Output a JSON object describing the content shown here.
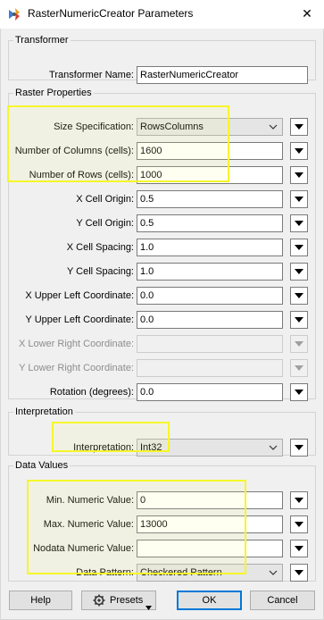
{
  "window": {
    "title": "RasterNumericCreator Parameters",
    "close_glyph": "✕"
  },
  "colors": {
    "highlight": "#f6f62a",
    "default_button_border": "#0078d7",
    "panel_background": "#f0f0f0"
  },
  "transformer": {
    "legend": "Transformer",
    "name_label": "Transformer Name:",
    "name_value": "RasterNumericCreator"
  },
  "raster_properties": {
    "legend": "Raster Properties",
    "size_spec_label": "Size Specification:",
    "size_spec_value": "RowsColumns",
    "columns_label": "Number of Columns (cells):",
    "columns_value": "1600",
    "rows_label": "Number of Rows (cells):",
    "rows_value": "1000",
    "x_origin_label": "X Cell Origin:",
    "x_origin_value": "0.5",
    "y_origin_label": "Y Cell Origin:",
    "y_origin_value": "0.5",
    "x_spacing_label": "X Cell Spacing:",
    "x_spacing_value": "1.0",
    "y_spacing_label": "Y Cell Spacing:",
    "y_spacing_value": "1.0",
    "x_ul_label": "X Upper Left Coordinate:",
    "x_ul_value": "0.0",
    "y_ul_label": "Y Upper Left Coordinate:",
    "y_ul_value": "0.0",
    "x_lr_label": "X Lower Right Coordinate:",
    "x_lr_value": "",
    "y_lr_label": "Y Lower Right Coordinate:",
    "y_lr_value": "",
    "rotation_label": "Rotation (degrees):",
    "rotation_value": "0.0"
  },
  "interpretation": {
    "legend": "Interpretation",
    "label": "Interpretation:",
    "value": "Int32"
  },
  "data_values": {
    "legend": "Data Values",
    "min_label": "Min. Numeric Value:",
    "min_value": "0",
    "max_label": "Max. Numeric Value:",
    "max_value": "13000",
    "nodata_label": "Nodata Numeric Value:",
    "nodata_value": "",
    "pattern_label": "Data Pattern:",
    "pattern_value": "Checkered Pattern"
  },
  "buttons": {
    "help": "Help",
    "presets": "Presets",
    "ok": "OK",
    "cancel": "Cancel"
  },
  "icons": {
    "app": "fme-transformer-icon",
    "presets": "gear-icon",
    "dropdown": "chevron-down-icon",
    "menu": "triangle-down-icon"
  }
}
